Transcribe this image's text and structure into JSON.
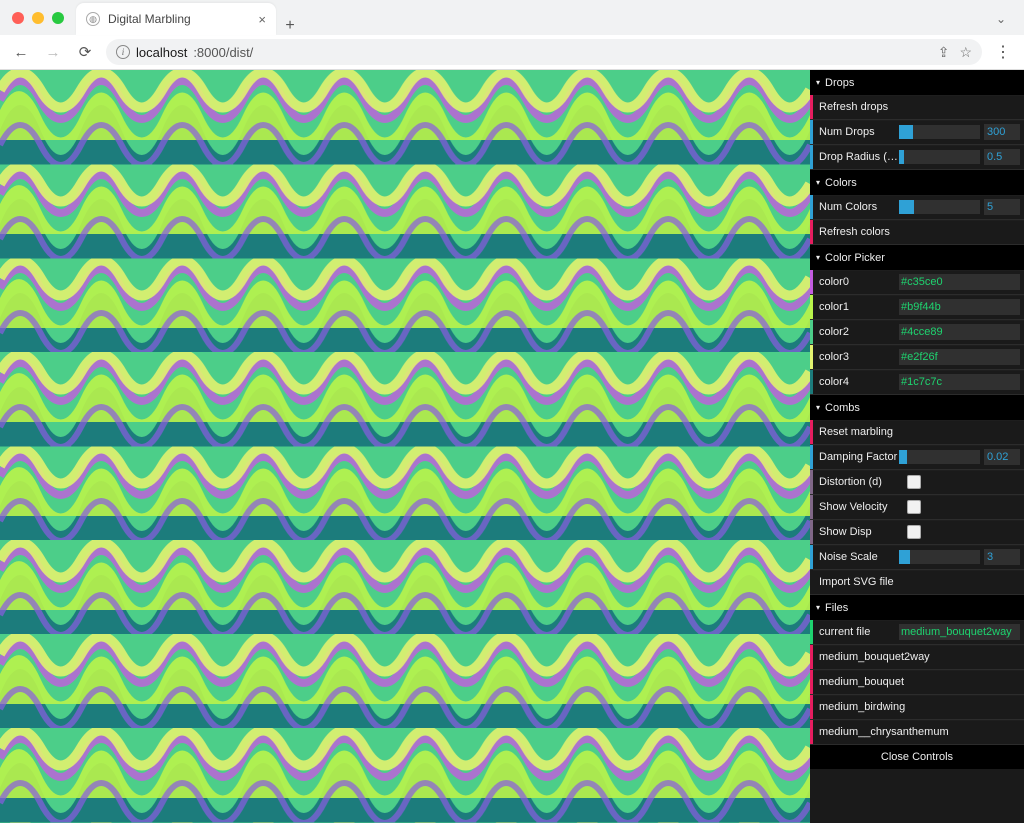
{
  "browser": {
    "tab_title": "Digital Marbling",
    "url_host": "localhost",
    "url_rest": ":8000/dist/"
  },
  "gui": {
    "folders": {
      "drops": {
        "title": "Drops",
        "refresh": "Refresh drops",
        "num_drops_label": "Num Drops",
        "num_drops_value": "300",
        "num_drops_fill_pct": 17,
        "radius_label": "Drop Radius (in)",
        "radius_value": "0.5",
        "radius_fill_pct": 6
      },
      "colors": {
        "title": "Colors",
        "num_colors_label": "Num Colors",
        "num_colors_value": "5",
        "num_colors_fill_pct": 18,
        "refresh": "Refresh colors"
      },
      "picker": {
        "title": "Color Picker",
        "entries": [
          {
            "label": "color0",
            "value": "#c35ce0"
          },
          {
            "label": "color1",
            "value": "#b9f44b"
          },
          {
            "label": "color2",
            "value": "#4cce89"
          },
          {
            "label": "color3",
            "value": "#e2f26f"
          },
          {
            "label": "color4",
            "value": "#1c7c7c"
          }
        ]
      },
      "combs": {
        "title": "Combs",
        "reset": "Reset marbling",
        "damping_label": "Damping Factor",
        "damping_value": "0.02",
        "damping_fill_pct": 10,
        "distortion_label": "Distortion (d)",
        "show_velocity_label": "Show Velocity",
        "show_disp_label": "Show Disp",
        "noise_scale_label": "Noise Scale",
        "noise_scale_value": "3",
        "noise_scale_fill_pct": 14,
        "import_svg_label": "Import SVG file"
      },
      "files": {
        "title": "Files",
        "current_label": "current file",
        "current_value": "medium_bouquet2way",
        "items": [
          "medium_bouquet2way",
          "medium_bouquet",
          "medium_birdwing",
          "medium__chrysanthemum"
        ]
      }
    },
    "close": "Close Controls"
  }
}
